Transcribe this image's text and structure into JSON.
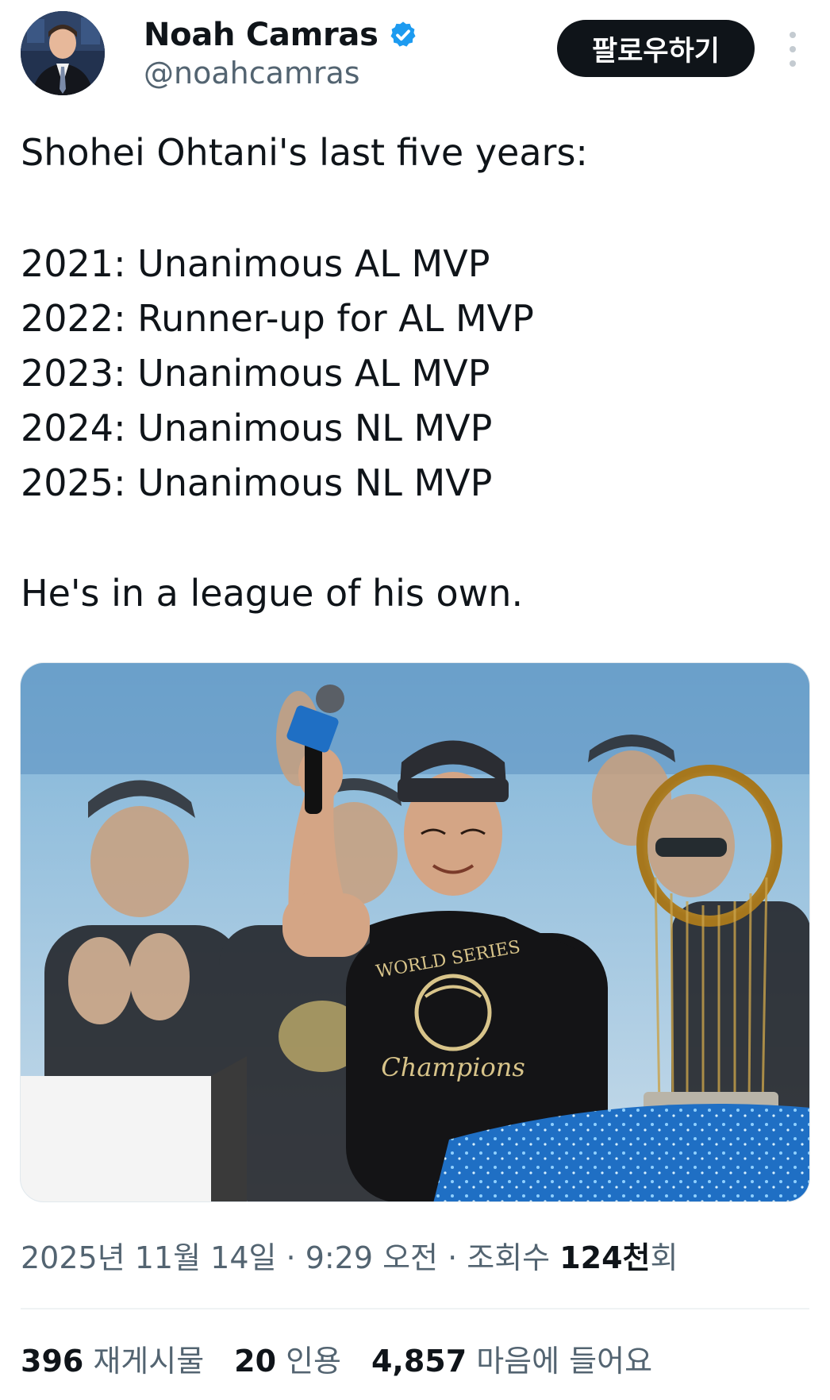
{
  "author": {
    "display_name": "Noah Camras",
    "handle": "@noahcamras",
    "verified": true,
    "avatar_icon": "profile-photo"
  },
  "header": {
    "follow_label": "팔로우하기",
    "more_icon": "more-vertical-icon"
  },
  "tweet": {
    "lines": [
      "Shohei Ohtani's last five years:",
      "2021: Unanimous AL MVP",
      "2022: Runner-up for AL MVP",
      "2023: Unanimous AL MVP",
      "2024: Unanimous NL MVP",
      "2025: Unanimous NL MVP",
      "He's in a league of his own."
    ],
    "image": {
      "shirt_text_top": "WORLD SERIES",
      "shirt_text_bottom": "Champions"
    }
  },
  "meta": {
    "date_time": "2025년 11월 14일 · 9:29 오전 · 조회수 ",
    "views_count": "124천",
    "views_suffix": "회"
  },
  "stats": {
    "reposts_count": "396",
    "reposts_label": "재게시물",
    "quotes_count": "20",
    "quotes_label": "인용",
    "likes_count": "4,857",
    "likes_label": "마음에 들어요"
  },
  "colors": {
    "text_primary": "#0f1419",
    "text_secondary": "#536471",
    "verified_blue": "#1d9bf0",
    "button_bg": "#0f1419",
    "divider": "#eff3f4"
  }
}
